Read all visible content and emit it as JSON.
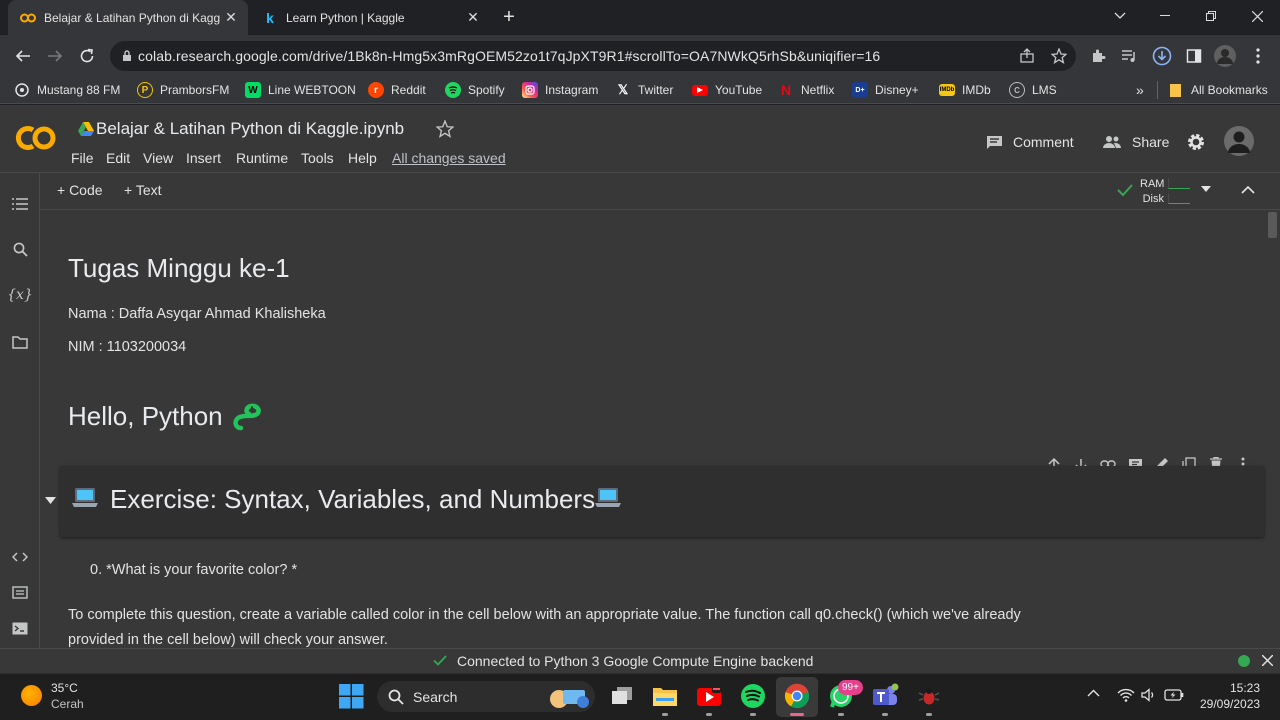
{
  "browser": {
    "tabs": [
      {
        "title": "Belajar & Latihan Python di Kaggle.ipynb",
        "active": true
      },
      {
        "title": "Learn Python | Kaggle",
        "active": false
      }
    ],
    "url": "colab.research.google.com/drive/1Bk8n-Hmg5x3mRgOEM52zo1t7qJpXT9R1#scrollTo=OA7NWkQ5rhSb&uniqifier=16",
    "bookmarks": [
      {
        "label": "Mustang 88 FM",
        "icon": "radio-icon",
        "color": "#e3e3e3"
      },
      {
        "label": "PramborsFM",
        "icon": "prambors-icon",
        "color": "#f5c400"
      },
      {
        "label": "Line WEBTOON",
        "icon": "webtoon-icon",
        "color": "#00dc64"
      },
      {
        "label": "Reddit",
        "icon": "reddit-icon",
        "color": "#ff4500"
      },
      {
        "label": "Spotify",
        "icon": "spotify-icon",
        "color": "#1ed760"
      },
      {
        "label": "Instagram",
        "icon": "instagram-icon",
        "color": "#d6249f"
      },
      {
        "label": "Twitter",
        "icon": "x-icon",
        "color": "#ffffff"
      },
      {
        "label": "YouTube",
        "icon": "youtube-icon",
        "color": "#ff0000"
      },
      {
        "label": "Netflix",
        "icon": "netflix-icon",
        "color": "#e50914"
      },
      {
        "label": "Disney+",
        "icon": "disney-icon",
        "color": "#1a3d8f"
      },
      {
        "label": "IMDb",
        "icon": "imdb-icon",
        "color": "#f5c518"
      },
      {
        "label": "LMS",
        "icon": "lms-icon",
        "color": "#bdbdbd"
      }
    ],
    "bookmarks_more": "»",
    "all_bookmarks": "All Bookmarks"
  },
  "colab": {
    "doc_name": "Belajar & Latihan Python di Kaggle.ipynb",
    "menu": [
      "File",
      "Edit",
      "View",
      "Insert",
      "Runtime",
      "Tools",
      "Help"
    ],
    "saved_status": "All changes saved",
    "comment_label": "Comment",
    "share_label": "Share",
    "add_code": "+ Code",
    "add_text": "+ Text",
    "ram_label": "RAM",
    "disk_label": "Disk"
  },
  "notebook": {
    "heading1": "Tugas Minggu ke-1",
    "nama": "Nama : Daffa Asyqar Ahmad Khalisheka",
    "nim": "NIM : 1103200034",
    "heading2": "Hello, Python",
    "exercise_title": "Exercise: Syntax, Variables, and Numbers",
    "question": "0. *What is your favorite color? *",
    "paragraph": "To complete this question, create a variable called color in the cell below with an appropriate value. The function call q0.check() (which we've already provided in the cell below) will check your answer."
  },
  "status": {
    "text": "Connected to Python 3 Google Compute Engine backend"
  },
  "taskbar": {
    "weather_temp": "35°C",
    "weather_desc": "Cerah",
    "search": "Search",
    "badge": "99+",
    "time": "15:23",
    "date": "29/09/2023"
  },
  "colors": {
    "accent_green": "#34a853",
    "colab_orange": "#f9ab00",
    "background": "#383838"
  }
}
